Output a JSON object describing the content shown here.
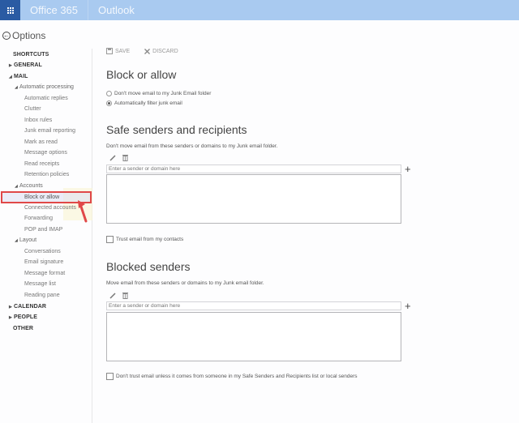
{
  "topbar": {
    "launcher_icon": "app-launcher-waffle-icon",
    "brand": "Office 365",
    "app": "Outlook"
  },
  "options": {
    "back_icon": "back-arrow-circle-icon",
    "title": "Options"
  },
  "sidebar": {
    "items": [
      {
        "label": "SHORTCUTS",
        "level": 0,
        "expander": ""
      },
      {
        "label": "GENERAL",
        "level": 0,
        "expander": "collapsed"
      },
      {
        "label": "MAIL",
        "level": 0,
        "expander": "expanded"
      },
      {
        "label": "Automatic processing",
        "level": 1,
        "expander": "expanded"
      },
      {
        "label": "Automatic replies",
        "level": 2
      },
      {
        "label": "Clutter",
        "level": 2
      },
      {
        "label": "Inbox rules",
        "level": 2
      },
      {
        "label": "Junk email reporting",
        "level": 2
      },
      {
        "label": "Mark as read",
        "level": 2
      },
      {
        "label": "Message options",
        "level": 2
      },
      {
        "label": "Read receipts",
        "level": 2
      },
      {
        "label": "Retention policies",
        "level": 2
      },
      {
        "label": "Accounts",
        "level": 1,
        "expander": "expanded"
      },
      {
        "label": "Block or allow",
        "level": 2,
        "selected": true
      },
      {
        "label": "Connected accounts",
        "level": 2
      },
      {
        "label": "Forwarding",
        "level": 2
      },
      {
        "label": "POP and IMAP",
        "level": 2
      },
      {
        "label": "Layout",
        "level": 1,
        "expander": "expanded"
      },
      {
        "label": "Conversations",
        "level": 2
      },
      {
        "label": "Email signature",
        "level": 2
      },
      {
        "label": "Message format",
        "level": 2
      },
      {
        "label": "Message list",
        "level": 2
      },
      {
        "label": "Reading pane",
        "level": 2
      },
      {
        "label": "CALENDAR",
        "level": 0,
        "expander": "collapsed"
      },
      {
        "label": "PEOPLE",
        "level": 0,
        "expander": "collapsed"
      },
      {
        "label": "OTHER",
        "level": 0,
        "expander": ""
      }
    ],
    "annotation_color": "#e04848"
  },
  "toolbar": {
    "save_label": "SAVE",
    "discard_label": "DISCARD"
  },
  "main": {
    "title": "Block or allow",
    "radio_options": [
      {
        "label": "Don't move email to my Junk Email folder",
        "checked": false
      },
      {
        "label": "Automatically filter junk email",
        "checked": true
      }
    ],
    "safe_senders": {
      "title": "Safe senders and recipients",
      "description": "Don't move email from these senders or domains to my Junk email folder.",
      "input_placeholder": "Enter a sender or domain here",
      "add_icon": "plus-icon",
      "checkbox_label": "Trust email from my contacts",
      "checkbox_checked": false
    },
    "blocked_senders": {
      "title": "Blocked senders",
      "description": "Move email from these senders or domains to my Junk email folder.",
      "input_placeholder": "Enter a sender or domain here",
      "add_icon": "plus-icon",
      "checkbox_label": "Don't trust email unless it comes from someone in my Safe Senders and Recipients list or local senders",
      "checkbox_checked": false
    }
  },
  "colors": {
    "topbar": "#a9caf0",
    "launcher": "#2a5ba3",
    "annotation": "#e04848"
  }
}
